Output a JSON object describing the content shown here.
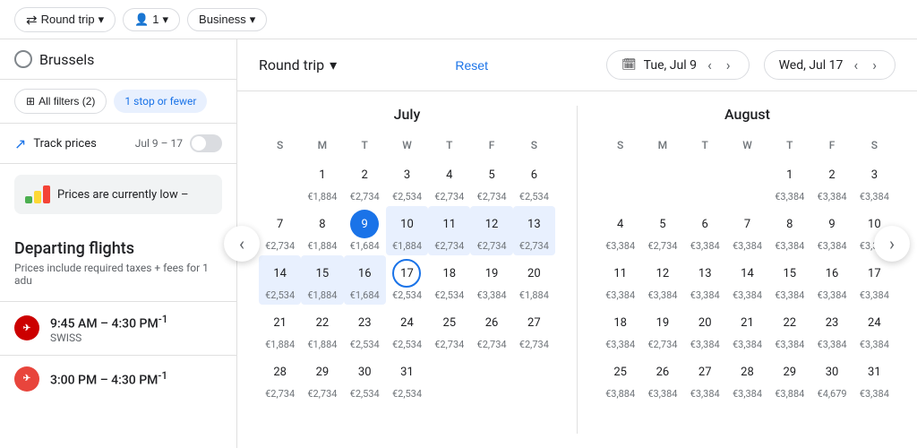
{
  "topbar": {
    "trip_type": "Round trip",
    "passengers": "1",
    "cabin": "Business"
  },
  "sidebar": {
    "search_city": "Brussels",
    "filters_label": "All filters (2)",
    "stops_chip": "1 stop or fewer",
    "track_label": "Track prices",
    "track_info_icon": "ⓘ",
    "track_dates": "Jul 9 – 17",
    "prices_banner": "Prices are currently low –",
    "departing_title": "Departing flights",
    "departing_sub": "Prices include required taxes + fees for 1 adu",
    "flights": [
      {
        "time": "9:45 AM – 4:30 PM",
        "superscript": "-1",
        "airline": "SWISS",
        "logo_color": "#cc0000"
      },
      {
        "time": "3:00 PM – 4:30 PM",
        "superscript": "-1",
        "airline": "",
        "logo_color": "#e8453c"
      }
    ]
  },
  "calendar": {
    "trip_type": "Round trip",
    "reset_label": "Reset",
    "depart_date": "Tue, Jul 9",
    "return_date": "Wed, Jul 17",
    "calendar_icon": "📅",
    "july": {
      "month_name": "July",
      "day_headers": [
        "S",
        "M",
        "T",
        "W",
        "T",
        "F",
        "S"
      ],
      "weeks": [
        [
          {
            "num": "",
            "price": ""
          },
          {
            "num": "1",
            "price": "€1,884"
          },
          {
            "num": "2",
            "price": "€2,734"
          },
          {
            "num": "3",
            "price": "€2,534"
          },
          {
            "num": "4",
            "price": "€2,734"
          },
          {
            "num": "5",
            "price": "€2,734"
          },
          {
            "num": "6",
            "price": "€2,534"
          }
        ],
        [
          {
            "num": "7",
            "price": "€2,734"
          },
          {
            "num": "8",
            "price": "€1,884"
          },
          {
            "num": "9",
            "price": "€1,684",
            "selected": true
          },
          {
            "num": "10",
            "price": "€1,884",
            "in_range": true
          },
          {
            "num": "11",
            "price": "€2,734",
            "in_range": true
          },
          {
            "num": "12",
            "price": "€2,734",
            "in_range": true
          },
          {
            "num": "13",
            "price": "€2,734",
            "in_range": true
          }
        ],
        [
          {
            "num": "14",
            "price": "€2,534",
            "in_range": true
          },
          {
            "num": "15",
            "price": "€1,884",
            "in_range": true
          },
          {
            "num": "16",
            "price": "€1,684",
            "in_range": true
          },
          {
            "num": "17",
            "price": "€2,534",
            "selected_end": true
          },
          {
            "num": "18",
            "price": "€2,534"
          },
          {
            "num": "19",
            "price": "€3,384"
          },
          {
            "num": "20",
            "price": "€1,884"
          }
        ],
        [
          {
            "num": "21",
            "price": "€1,884"
          },
          {
            "num": "22",
            "price": "€1,884"
          },
          {
            "num": "23",
            "price": "€2,534"
          },
          {
            "num": "24",
            "price": "€2,534"
          },
          {
            "num": "25",
            "price": "€2,734"
          },
          {
            "num": "26",
            "price": "€2,734"
          },
          {
            "num": "27",
            "price": "€2,734"
          }
        ],
        [
          {
            "num": "28",
            "price": "€2,734"
          },
          {
            "num": "29",
            "price": "€2,734"
          },
          {
            "num": "30",
            "price": "€2,534"
          },
          {
            "num": "31",
            "price": "€2,534"
          },
          {
            "num": "",
            "price": ""
          },
          {
            "num": "",
            "price": ""
          },
          {
            "num": "",
            "price": ""
          }
        ]
      ]
    },
    "august": {
      "month_name": "August",
      "day_headers": [
        "S",
        "M",
        "T",
        "W",
        "T",
        "F",
        "S"
      ],
      "weeks": [
        [
          {
            "num": "",
            "price": ""
          },
          {
            "num": "",
            "price": ""
          },
          {
            "num": "",
            "price": ""
          },
          {
            "num": "",
            "price": ""
          },
          {
            "num": "1",
            "price": "€3,384"
          },
          {
            "num": "2",
            "price": "€3,384"
          },
          {
            "num": "3",
            "price": "€3,384"
          }
        ],
        [
          {
            "num": "4",
            "price": "€3,384"
          },
          {
            "num": "5",
            "price": "€2,734"
          },
          {
            "num": "6",
            "price": "€3,384"
          },
          {
            "num": "7",
            "price": "€3,384"
          },
          {
            "num": "8",
            "price": "€3,384"
          },
          {
            "num": "9",
            "price": "€3,384"
          },
          {
            "num": "10",
            "price": "€3,384"
          }
        ],
        [
          {
            "num": "11",
            "price": "€3,384"
          },
          {
            "num": "12",
            "price": "€3,384"
          },
          {
            "num": "13",
            "price": "€3,384"
          },
          {
            "num": "14",
            "price": "€3,384"
          },
          {
            "num": "15",
            "price": "€3,384"
          },
          {
            "num": "16",
            "price": "€3,384"
          },
          {
            "num": "17",
            "price": "€3,384"
          }
        ],
        [
          {
            "num": "18",
            "price": "€3,384"
          },
          {
            "num": "19",
            "price": "€2,734"
          },
          {
            "num": "20",
            "price": "€3,384"
          },
          {
            "num": "21",
            "price": "€3,384"
          },
          {
            "num": "22",
            "price": "€3,384"
          },
          {
            "num": "23",
            "price": "€3,384"
          },
          {
            "num": "24",
            "price": "€3,384"
          }
        ],
        [
          {
            "num": "25",
            "price": "€3,884"
          },
          {
            "num": "26",
            "price": "€3,384"
          },
          {
            "num": "27",
            "price": "€3,384"
          },
          {
            "num": "28",
            "price": "€3,384"
          },
          {
            "num": "29",
            "price": "€3,884"
          },
          {
            "num": "30",
            "price": "€4,679"
          },
          {
            "num": "31",
            "price": "€3,384"
          }
        ]
      ]
    }
  },
  "icons": {
    "round_trip": "⇄",
    "person": "👤",
    "chevron_down": "▾",
    "chevron_left": "‹",
    "chevron_right": "›",
    "filter": "⊞",
    "trend": "↗",
    "calendar": "🗓"
  }
}
